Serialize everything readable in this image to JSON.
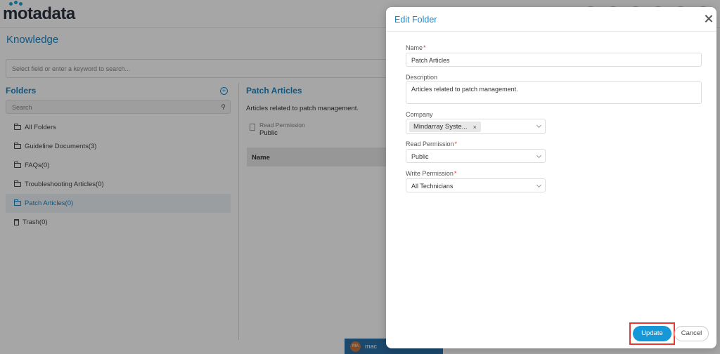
{
  "app": {
    "logo": "motadata"
  },
  "page": {
    "title": "Knowledge",
    "search_placeholder": "Select field or enter a keyword to search..."
  },
  "folders": {
    "title": "Folders",
    "search_placeholder": "Search",
    "items": [
      {
        "label": "All Folders"
      },
      {
        "label": "Guideline Documents(3)"
      },
      {
        "label": "FAQs(0)"
      },
      {
        "label": "Troubleshooting Articles(0)"
      },
      {
        "label": "Patch Articles(0)"
      },
      {
        "label": "Trash(0)"
      }
    ]
  },
  "detail": {
    "title": "Patch Articles",
    "description": "Articles related to patch management.",
    "read_permission_label": "Read Permission",
    "read_permission_value": "Public",
    "table_header": "Name"
  },
  "footer": {
    "user_initials": "MA",
    "user_name": "mac"
  },
  "modal": {
    "title": "Edit Folder",
    "name_label": "Name",
    "name_value": "Patch Articles",
    "description_label": "Description",
    "description_value": "Articles related to patch management.",
    "company_label": "Company",
    "company_tag": "Mindarray Syste...",
    "read_permission_label": "Read Permission",
    "read_permission_value": "Public",
    "write_permission_label": "Write Permission",
    "write_permission_value": "All Technicians",
    "update_label": "Update",
    "cancel_label": "Cancel"
  },
  "colors": {
    "accent": "#1a86c8",
    "primary_button": "#1597d8",
    "required": "#e53935",
    "highlight": "#e53935"
  }
}
